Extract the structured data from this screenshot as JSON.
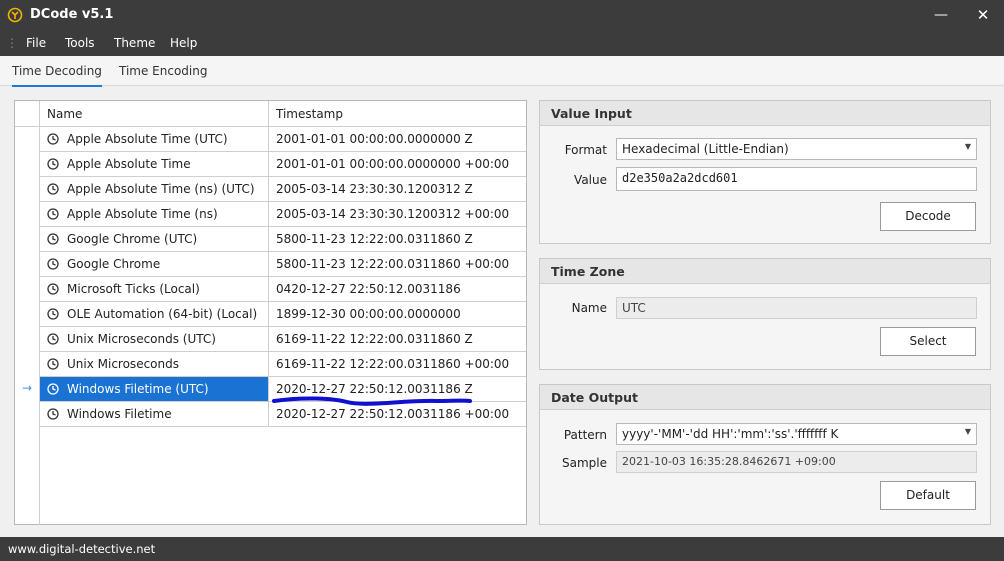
{
  "window": {
    "title": "DCode v5.1",
    "minimize": "—",
    "close": "✕"
  },
  "menu": [
    "File",
    "Tools",
    "Theme",
    "Help"
  ],
  "tabs": [
    "Time Decoding",
    "Time Encoding"
  ],
  "grid": {
    "columns": [
      "Name",
      "Timestamp"
    ],
    "selected_index": 9,
    "rows": [
      {
        "name": "Apple Absolute Time (UTC)",
        "timestamp": "2001-01-01 00:00:00.0000000 Z"
      },
      {
        "name": "Apple Absolute Time",
        "timestamp": "2001-01-01 00:00:00.0000000 +00:00"
      },
      {
        "name": "Apple Absolute Time (ns) (UTC)",
        "timestamp": "2005-03-14 23:30:30.1200312 Z"
      },
      {
        "name": "Apple Absolute Time (ns)",
        "timestamp": "2005-03-14 23:30:30.1200312 +00:00"
      },
      {
        "name": "Google Chrome (UTC)",
        "timestamp": "5800-11-23 12:22:00.0311860 Z"
      },
      {
        "name": "Google Chrome",
        "timestamp": "5800-11-23 12:22:00.0311860 +00:00"
      },
      {
        "name": "Microsoft Ticks (Local)",
        "timestamp": "0420-12-27 22:50:12.0031186"
      },
      {
        "name": "OLE Automation (64-bit) (Local)",
        "timestamp": "1899-12-30 00:00:00.0000000"
      },
      {
        "name": "Unix Microseconds (UTC)",
        "timestamp": "6169-11-22 12:22:00.0311860 Z"
      },
      {
        "name": "Unix Microseconds",
        "timestamp": "6169-11-22 12:22:00.0311860 +00:00"
      },
      {
        "name": "Windows Filetime (UTC)",
        "timestamp": "2020-12-27 22:50:12.0031186 Z"
      },
      {
        "name": "Windows Filetime",
        "timestamp": "2020-12-27 22:50:12.0031186 +00:00"
      }
    ]
  },
  "value_input": {
    "heading": "Value Input",
    "format_label": "Format",
    "format_value": "Hexadecimal (Little-Endian)",
    "value_label": "Value",
    "value": "d2e350a2a2dcd601",
    "decode_button": "Decode"
  },
  "time_zone": {
    "heading": "Time Zone",
    "name_label": "Name",
    "name_value": "UTC",
    "select_button": "Select"
  },
  "date_output": {
    "heading": "Date Output",
    "pattern_label": "Pattern",
    "pattern_value": "yyyy'-'MM'-'dd HH':'mm':'ss'.'fffffff K",
    "sample_label": "Sample",
    "sample_value": "2021-10-03 16:35:28.8462671 +09:00",
    "default_button": "Default"
  },
  "status": {
    "url": "www.digital-detective.net"
  },
  "colors": {
    "selection": "#1a73d2",
    "annotation": "#1010d0",
    "chrome": "#3c3c3c",
    "accent": "#1e78d4"
  }
}
